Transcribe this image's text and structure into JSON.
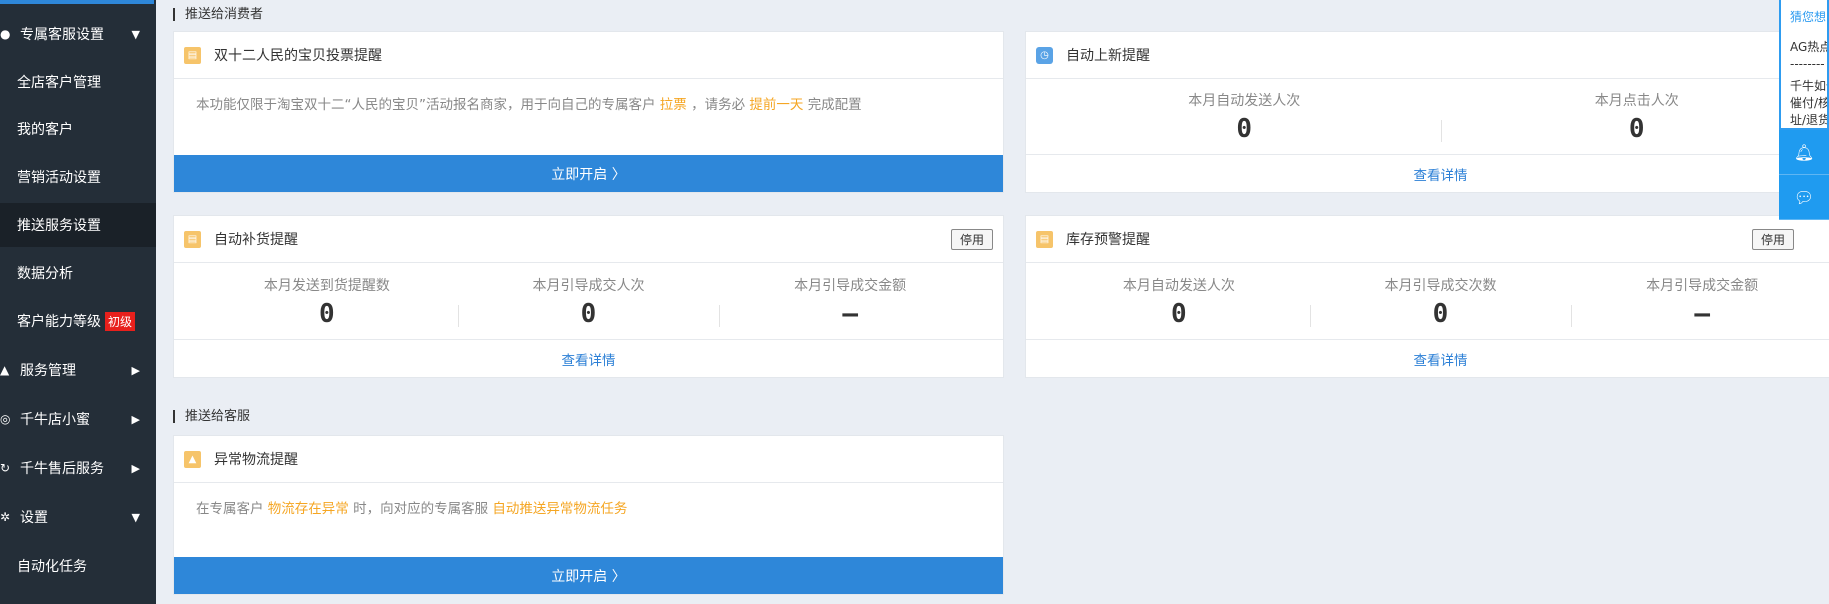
{
  "sidebar": {
    "items": [
      {
        "label": "专属客服设置",
        "icon": "user-icon",
        "arrow": "▼"
      },
      {
        "label": "全店客户管理"
      },
      {
        "label": "我的客户"
      },
      {
        "label": "营销活动设置"
      },
      {
        "label": "推送服务设置"
      },
      {
        "label": "数据分析"
      },
      {
        "label": "客户能力等级",
        "badge": "初级"
      },
      {
        "label": "服务管理",
        "icon": "bell-icon",
        "arrow": "▶"
      },
      {
        "label": "千牛店小蜜",
        "icon": "robot-icon",
        "arrow": "▶"
      },
      {
        "label": "千牛售后服务",
        "icon": "refresh-icon",
        "arrow": "▶"
      },
      {
        "label": "设置",
        "icon": "gear-icon",
        "arrow": "▼"
      },
      {
        "label": "自动化任务"
      }
    ]
  },
  "sections": {
    "consumer": "推送给消费者",
    "service": "推送给客服"
  },
  "vote_card": {
    "title": "双十二人民的宝贝投票提醒",
    "desc_1": "本功能仅限于淘宝双十二“人民的宝贝”活动报名商家，用于向自己的专属客户",
    "hl_1": "拉票",
    "desc_2": "，请务必",
    "hl_2": "提前一天",
    "desc_3": "完成配置",
    "button": "立即开启 〉"
  },
  "new_card": {
    "title": "自动上新提醒",
    "stats": [
      {
        "label": "本月自动发送人次",
        "value": "0"
      },
      {
        "label": "本月点击人次",
        "value": "0"
      }
    ],
    "link": "查看详情"
  },
  "restock_card": {
    "title": "自动补货提醒",
    "stop": "停用",
    "stats": [
      {
        "label": "本月发送到货提醒数",
        "value": "0"
      },
      {
        "label": "本月引导成交人次",
        "value": "0"
      },
      {
        "label": "本月引导成交金额",
        "value": "—"
      }
    ],
    "link": "查看详情"
  },
  "stock_card": {
    "title": "库存预警提醒",
    "stop": "停用",
    "stats": [
      {
        "label": "本月自动发送人次",
        "value": "0"
      },
      {
        "label": "本月引导成交次数",
        "value": "0"
      },
      {
        "label": "本月引导成交金额",
        "value": "—"
      }
    ],
    "link": "查看详情"
  },
  "logistics_card": {
    "title": "异常物流提醒",
    "desc_1": "在专属客户",
    "hl_1": "物流存在异常",
    "desc_2": "时，向对应的专属客服",
    "hl_2": "自动推送异常物流任务",
    "button": "立即开启 〉"
  },
  "right_panel": {
    "question": "猜您想问",
    "line1": "AG热点",
    "dashes": "--------",
    "line2": "千牛如何",
    "line3": "催付/核",
    "line4": "址/退货"
  },
  "colors": {
    "primary": "#2e87d9",
    "highlight": "#f5a623",
    "sidebar": "#242e38"
  }
}
